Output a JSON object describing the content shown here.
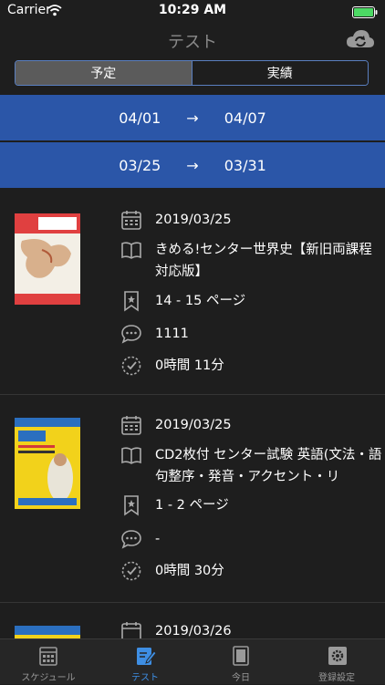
{
  "status": {
    "carrier": "Carrier",
    "time": "10:29 AM"
  },
  "nav": {
    "title": "テスト",
    "action_icon": "cloud-sync-icon"
  },
  "segments": {
    "left": "予定",
    "right": "実績",
    "selected": "実績"
  },
  "week_ranges": [
    {
      "start": "04/01",
      "arrow": "→",
      "end": "04/07"
    },
    {
      "start": "03/25",
      "arrow": "→",
      "end": "03/31"
    }
  ],
  "records": [
    {
      "date": "2019/03/25",
      "title": "きめる!センター世界史【新旧両課程対応版】",
      "pages": "14 - 15 ページ",
      "comment": "1111",
      "duration": "0時間 11分",
      "cover": {
        "label_top": "きめる",
        "label_sub": "世界史",
        "color": "#d23a3a"
      }
    },
    {
      "date": "2019/03/25",
      "title": "CD2枚付 センター試験 英語(文法・語句整序・発音・アクセント・リ",
      "pages": "1 - 2 ページ",
      "comment": "-",
      "duration": "0時間 30分",
      "cover": {
        "label_top": "センター試験",
        "label_sub": "英語",
        "color": "#f2d21b"
      }
    },
    {
      "date": "2019/03/26",
      "cover": {
        "label_top": "センター試験",
        "color": "#f2d21b"
      }
    }
  ],
  "tabs": [
    {
      "label": "スケジュール",
      "icon": "calendar-icon"
    },
    {
      "label": "テスト",
      "icon": "edit-icon"
    },
    {
      "label": "今日",
      "icon": "book-icon"
    },
    {
      "label": "登録設定",
      "icon": "gear-icon"
    }
  ],
  "colors": {
    "band": "#2b56a8",
    "active_tab": "#3e8ee3",
    "battery": "#4cd964"
  }
}
